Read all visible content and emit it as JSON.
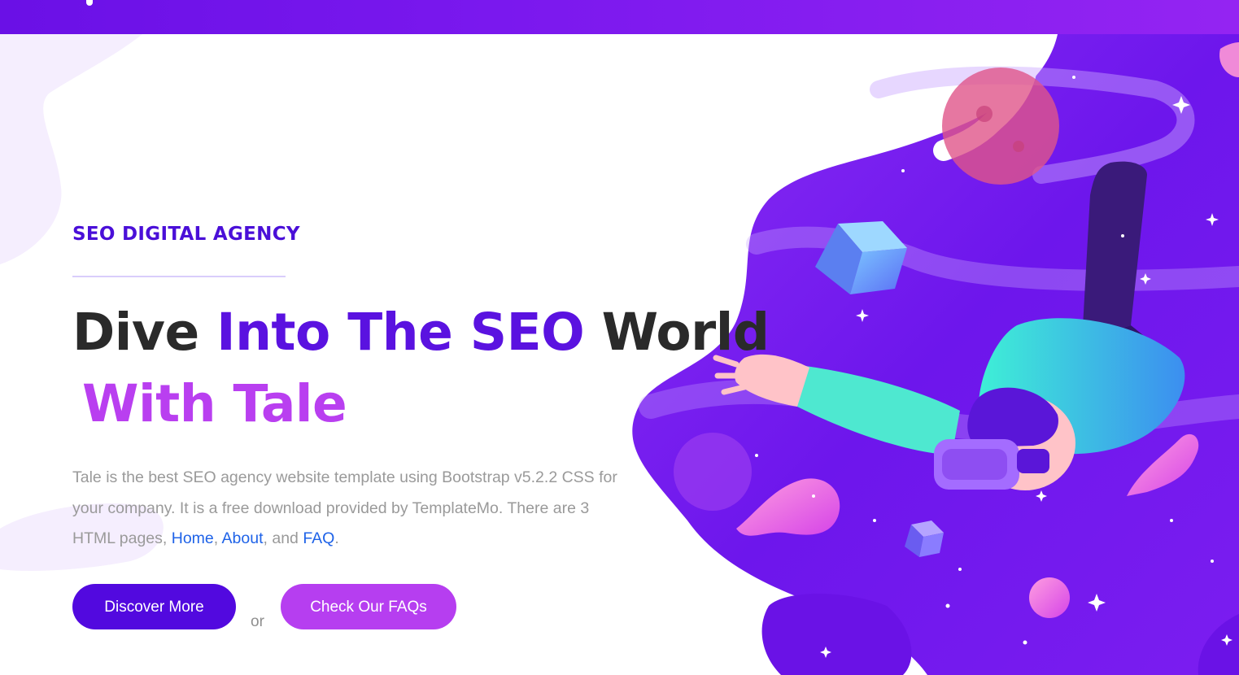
{
  "hero": {
    "eyebrow": "SEO DIGITAL AGENCY",
    "headline_part1": "Dive ",
    "headline_accent": "Into The SEO",
    "headline_part2": " World",
    "headline_line2": "With Tale",
    "description_text": "Tale is the best SEO agency website template using Bootstrap v5.2.2 CSS for your company. It is a free download provided by TemplateMo. There are 3 HTML pages, ",
    "links": {
      "home": "Home",
      "about": "About",
      "faq": "FAQ"
    },
    "sep1": ", ",
    "sep2": ", and ",
    "end": ".",
    "primary_button": "Discover More",
    "or_text": "or",
    "secondary_button": "Check Our FAQs"
  },
  "colors": {
    "topbar_start": "#6a10e6",
    "topbar_end": "#9424f2",
    "eyebrow": "#4a0fd8",
    "headline_dark": "#2a2a2a",
    "headline_accent": "#5a12e0",
    "headline_accent2": "#b93ff0",
    "link": "#1f63e8",
    "primary_button": "#5209df",
    "secondary_button": "#b63ef0"
  },
  "illustration": {
    "subject": "vr-astronaut-floating-in-space"
  }
}
